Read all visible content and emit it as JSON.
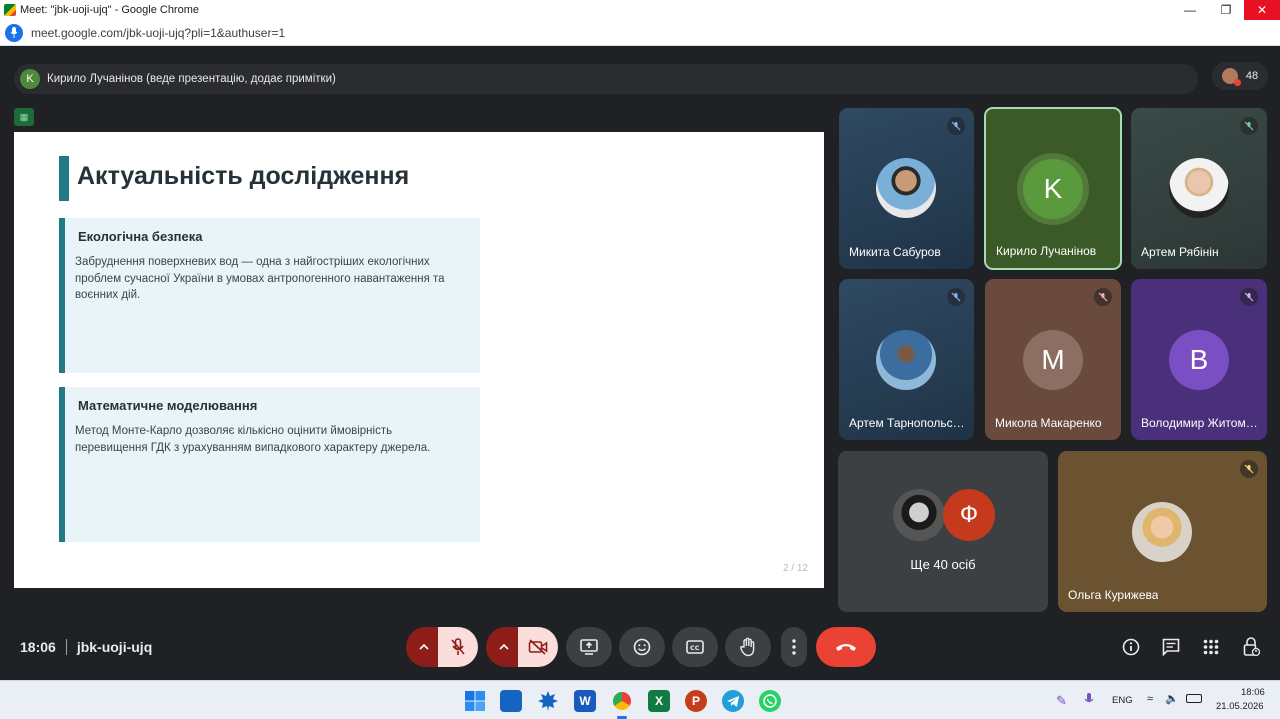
{
  "browser": {
    "window_title": "Meet: \"jbk-uoji-ujq\" - Google Chrome",
    "url": "meet.google.com/jbk-uoji-ujq?pli=1&authuser=1"
  },
  "banner": {
    "presenter_initial": "K",
    "text": "Кирило Лучанінов (веде презентацію, додає примітки)",
    "people_count": "48"
  },
  "slide": {
    "title": "Актуальність дослідження",
    "cards": [
      {
        "heading": "Екологічна безпека",
        "body": "Забруднення поверхневих вод — одна з найгостріших екологічних проблем сучасної України в умовах антропогенного навантаження та воєнних дій."
      },
      {
        "heading": "Математичне моделювання",
        "body": "Метод Монте-Карло дозволяє кількісно оцінити ймовірність перевищення ГДК з урахуванням випадкового характеру джерела."
      }
    ],
    "page_number": "2 / 12"
  },
  "participants": [
    {
      "name": "Микита Сабуров",
      "avatar_type": "photo",
      "muted": true
    },
    {
      "name": "Кирило Лучанінов",
      "avatar_type": "letter",
      "initial": "K",
      "muted": false,
      "active_speaker": true
    },
    {
      "name": "Артем Рябінін",
      "avatar_type": "photo",
      "muted": true
    },
    {
      "name": "Артем Тарнопольський",
      "avatar_type": "photo",
      "muted": true
    },
    {
      "name": "Микола Макаренко",
      "avatar_type": "letter",
      "initial": "M",
      "muted": true
    },
    {
      "name": "Володимир Житомирський",
      "avatar_type": "letter",
      "initial": "B",
      "muted": true
    },
    {
      "name": "Ольга Курижева",
      "avatar_type": "photo",
      "muted": true
    }
  ],
  "more_tile": {
    "initial": "Ф",
    "label": "Ще 40 осіб"
  },
  "bottom_bar": {
    "time": "18:06",
    "meeting_code": "jbk-uoji-ujq"
  },
  "taskbar": {
    "language": "ENG",
    "time": "18:06",
    "date": "21.05.2026"
  },
  "colors": {
    "meet_background": "#202124",
    "slide_accent": "#237a86",
    "card_background": "#e8f4f7",
    "leave_red": "#ea4335",
    "active_speaker_border": "#a8dab5"
  }
}
